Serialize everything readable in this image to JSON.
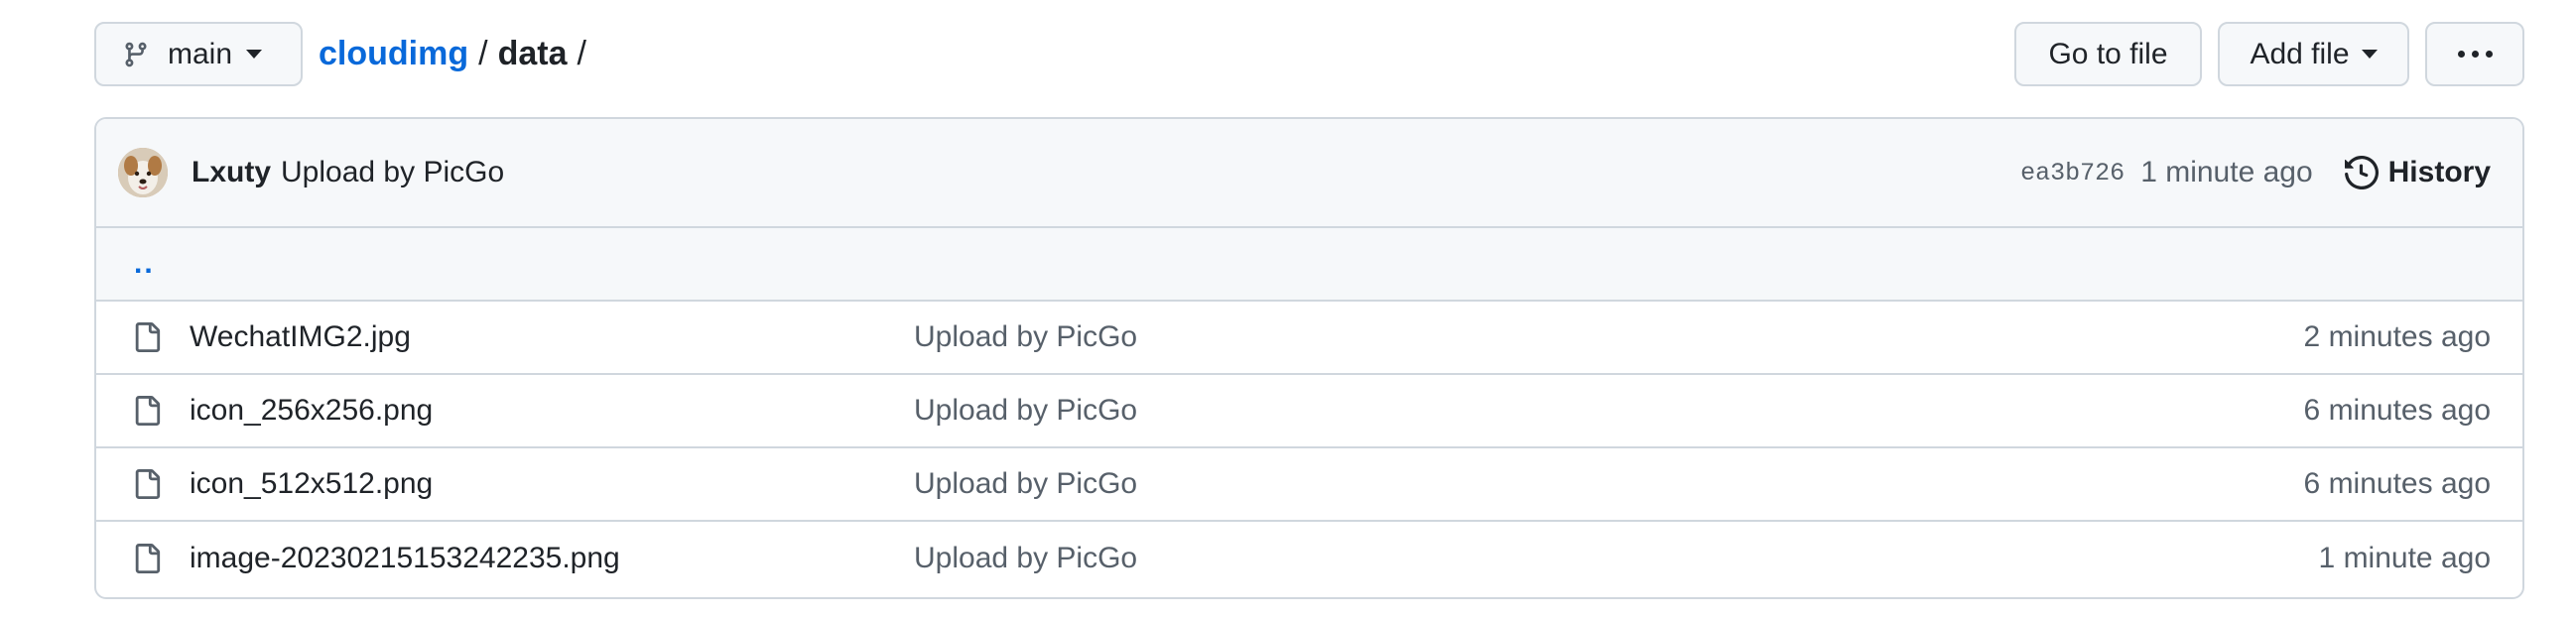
{
  "branch": {
    "name": "main"
  },
  "breadcrumb": {
    "repo": "cloudimg",
    "separator": "/",
    "dir": "data",
    "trailing": "/"
  },
  "actions": {
    "go_to_file": "Go to file",
    "add_file": "Add file"
  },
  "commit": {
    "author": "Lxuty",
    "message": "Upload by PicGo",
    "sha": "ea3b726",
    "time": "1 minute ago",
    "history_label": "History"
  },
  "parent_link": "..",
  "files": [
    {
      "name": "WechatIMG2.jpg",
      "message": "Upload by PicGo",
      "age": "2 minutes ago"
    },
    {
      "name": "icon_256x256.png",
      "message": "Upload by PicGo",
      "age": "6 minutes ago"
    },
    {
      "name": "icon_512x512.png",
      "message": "Upload by PicGo",
      "age": "6 minutes ago"
    },
    {
      "name": "image-20230215153242235.png",
      "message": "Upload by PicGo",
      "age": "1 minute ago"
    }
  ],
  "colors": {
    "link": "#0969da",
    "muted": "#57606a",
    "border": "#d0d7de",
    "header_bg": "#f6f8fa"
  }
}
